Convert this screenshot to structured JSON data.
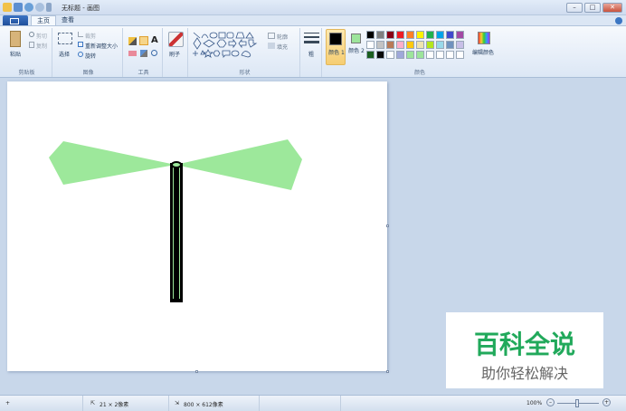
{
  "window": {
    "title": "无标题 - 画图"
  },
  "tabs": [
    {
      "label": "主页"
    },
    {
      "label": "查看"
    }
  ],
  "ribbon": {
    "clipboard": {
      "paste": "粘贴",
      "cut": "剪切",
      "copy": "复制",
      "label": "剪贴板"
    },
    "image": {
      "select": "选择",
      "crop": "裁剪",
      "resize": "重新调整大小",
      "rotate": "旋转",
      "label": "图像"
    },
    "tools": {
      "label": "工具"
    },
    "brushes": {
      "label": "刷子"
    },
    "shapes": {
      "outline": "轮廓",
      "fill": "填充",
      "label": "形状"
    },
    "size": {
      "label": "粗"
    },
    "color1": {
      "label": "颜色 1",
      "color": "#000000"
    },
    "color2": {
      "label": "颜色 2",
      "color": "#9de59b"
    },
    "colors": {
      "label": "颜色",
      "edit": "编辑颜色",
      "palette": [
        "#000000",
        "#7f7f7f",
        "#880015",
        "#ed1c24",
        "#ff7f27",
        "#fff200",
        "#22b14c",
        "#00a2e8",
        "#3f48cc",
        "#a349a4",
        "#ffffff",
        "#c3c3c3",
        "#b97a57",
        "#ffaec9",
        "#ffc90e",
        "#efe4b0",
        "#b5e61d",
        "#99d9ea",
        "#7092be",
        "#c8bfe7",
        "#1b5e20",
        "#0a0a0a",
        "#ffffff",
        "#9fa8da",
        "#9de59b",
        "#9de59b",
        "#ffffff",
        "#ffffff",
        "#ffffff",
        "#ffffff"
      ]
    }
  },
  "drawing": {
    "wing_color": "#9de89b",
    "stem_color": "#000000",
    "stem_inner": "#9de89b"
  },
  "status": {
    "cursor_pos": "21 × 2像素",
    "canvas_size": "800 × 612像素",
    "zoom": "100%"
  },
  "watermark": {
    "line1": "百科全说",
    "line2": "助你轻松解决"
  }
}
